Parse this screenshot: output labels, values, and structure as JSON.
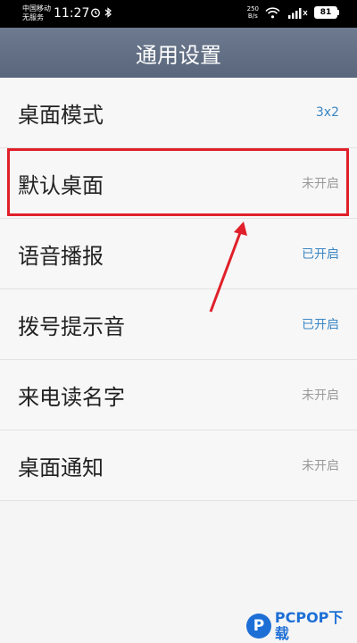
{
  "status_bar": {
    "carrier_line1": "中国移动",
    "carrier_line2": "无服务",
    "time": "11:27",
    "net_speed_value": "250",
    "net_speed_unit": "B/s",
    "battery": "81",
    "icons": [
      "alarm-icon",
      "bluetooth-icon",
      "wifi-icon",
      "signal-icon",
      "battery-icon"
    ]
  },
  "header": {
    "title": "通用设置"
  },
  "settings": {
    "items": [
      {
        "label": "桌面模式",
        "value": "3x2",
        "state": "on"
      },
      {
        "label": "默认桌面",
        "value": "未开启",
        "state": "off"
      },
      {
        "label": "语音播报",
        "value": "已开启",
        "state": "on"
      },
      {
        "label": "拨号提示音",
        "value": "已开启",
        "state": "on"
      },
      {
        "label": "来电读名字",
        "value": "未开启",
        "state": "off"
      },
      {
        "label": "桌面通知",
        "value": "未开启",
        "state": "off"
      }
    ]
  },
  "colors": {
    "header_bg": "#5f6c81",
    "value_on": "#3a86c4",
    "value_off": "#9a9a9a",
    "highlight": "#e0202a",
    "watermark": "#1d6fd6"
  },
  "watermark": {
    "text": "PCPOP下载"
  }
}
